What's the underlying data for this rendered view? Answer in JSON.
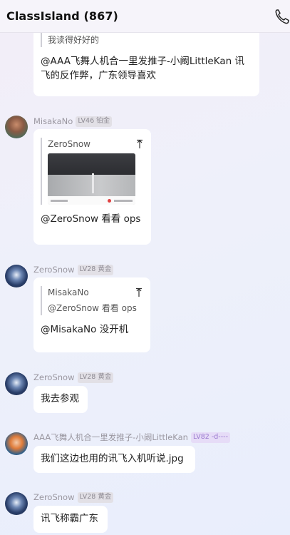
{
  "header": {
    "title": "ClassIsland (867)"
  },
  "messages": {
    "m0": {
      "quote_text": "我读得好好的",
      "text": "@AAA飞舞人机合一里发推子-小阚LittleKan 讯飞的反作弊，广东领导喜欢"
    },
    "m1": {
      "name": "MisakaNo",
      "badge": "LV46 铂金",
      "quote_name": "ZeroSnow",
      "text": "@ZeroSnow 看看 ops"
    },
    "m2": {
      "name": "ZeroSnow",
      "badge": "LV28 黄金",
      "quote_name": "MisakaNo",
      "quote_text": "@ZeroSnow 看看 ops",
      "text": "@MisakaNo 没开机"
    },
    "m3": {
      "name": "ZeroSnow",
      "badge": "LV28 黄金",
      "text": "我去参观"
    },
    "m4": {
      "name": "AAA飞舞人机合一里发推子-小阚LittleKan",
      "badge": "LV82 -d----",
      "text": "我们这边也用的讯飞入机听说.jpg"
    },
    "m5": {
      "name": "ZeroSnow",
      "badge": "LV28 黄金",
      "text": "讯飞称霸广东"
    }
  }
}
